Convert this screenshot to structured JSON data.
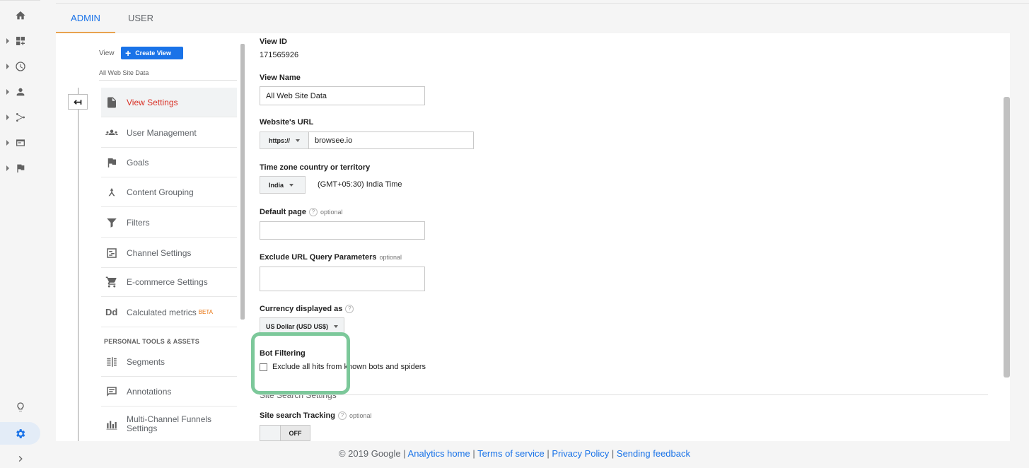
{
  "tabs": [
    {
      "label": "ADMIN"
    },
    {
      "label": "USER"
    }
  ],
  "rail": {
    "items": [
      "home-icon",
      "dashboard-icon",
      "clock-icon",
      "person-icon",
      "acquisition-icon",
      "behavior-icon",
      "flag-icon"
    ],
    "bottom": [
      "lightbulb-icon",
      "gear-icon",
      "chevron-right-icon"
    ]
  },
  "view_column": {
    "view_label": "View",
    "create_view_label": "Create View",
    "view_name": "All Web Site Data",
    "menu": [
      {
        "label": "View Settings",
        "icon": "document-icon",
        "active": true
      },
      {
        "label": "User Management",
        "icon": "people-icon"
      },
      {
        "label": "Goals",
        "icon": "flag-icon"
      },
      {
        "label": "Content Grouping",
        "icon": "grouping-icon"
      },
      {
        "label": "Filters",
        "icon": "filter-icon"
      },
      {
        "label": "Channel Settings",
        "icon": "channel-icon"
      },
      {
        "label": "E-commerce Settings",
        "icon": "cart-icon"
      },
      {
        "label": "Calculated metrics",
        "icon": "dd-icon",
        "badge": "BETA"
      }
    ],
    "section_heading": "PERSONAL TOOLS & ASSETS",
    "personal_menu": [
      {
        "label": "Segments",
        "icon": "segments-icon"
      },
      {
        "label": "Annotations",
        "icon": "annotations-icon"
      },
      {
        "label": "Multi-Channel Funnels Settings",
        "icon": "bar-chart-icon"
      }
    ]
  },
  "form": {
    "view_id_label": "View ID",
    "view_id_value": "171565926",
    "view_name_label": "View Name",
    "view_name_value": "All Web Site Data",
    "website_url_label": "Website's URL",
    "protocol": "https://",
    "url_value": "browsee.io",
    "timezone_label": "Time zone country or territory",
    "country": "India",
    "timezone_value": "(GMT+05:30) India Time",
    "default_page_label": "Default page",
    "default_page_optional": "optional",
    "default_page_value": "",
    "exclude_params_label": "Exclude URL Query Parameters",
    "exclude_params_optional": "optional",
    "currency_label": "Currency displayed as",
    "currency_value": "US Dollar (USD US$)",
    "bot_filtering_label": "Bot Filtering",
    "bot_filtering_checkbox_label": "Exclude all hits from known bots and spiders",
    "bot_filtering_checked": false,
    "site_search_heading": "Site Search Settings",
    "site_search_tracking_label": "Site search Tracking",
    "site_search_optional": "optional",
    "site_search_toggle_state": "OFF"
  },
  "footer": {
    "copyright": "© 2019 Google",
    "links": [
      "Analytics home",
      "Terms of service",
      "Privacy Policy",
      "Sending feedback"
    ]
  },
  "colors": {
    "accent": "#1a73e8",
    "active_menu": "#d93025",
    "highlight": "#7cc89a",
    "tab_underline": "#e8a34f"
  }
}
